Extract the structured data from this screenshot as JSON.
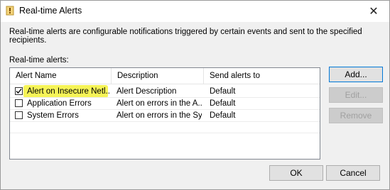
{
  "window": {
    "title": "Real-time Alerts",
    "close_glyph": "✕"
  },
  "description": "Real-time alerts are configurable notifications triggered by certain events and sent to the specified recipients.",
  "list": {
    "label": "Real-time alerts:",
    "columns": [
      "Alert Name",
      "Description",
      "Send alerts to"
    ],
    "rows": [
      {
        "checked": true,
        "name": "Alert on Insecure Netl...",
        "description": "Alert Description",
        "send_to": "Default",
        "highlighted": true
      },
      {
        "checked": false,
        "name": "Application Errors",
        "description": "Alert on errors in the A...",
        "send_to": "Default",
        "highlighted": false
      },
      {
        "checked": false,
        "name": "System Errors",
        "description": "Alert on errors in the Sy...",
        "send_to": "Default",
        "highlighted": false
      }
    ]
  },
  "buttons": {
    "add": "Add...",
    "edit": "Edit...",
    "remove": "Remove",
    "ok": "OK",
    "cancel": "Cancel"
  },
  "colors": {
    "highlight": "#f5f23a",
    "accent": "#0078d7"
  }
}
